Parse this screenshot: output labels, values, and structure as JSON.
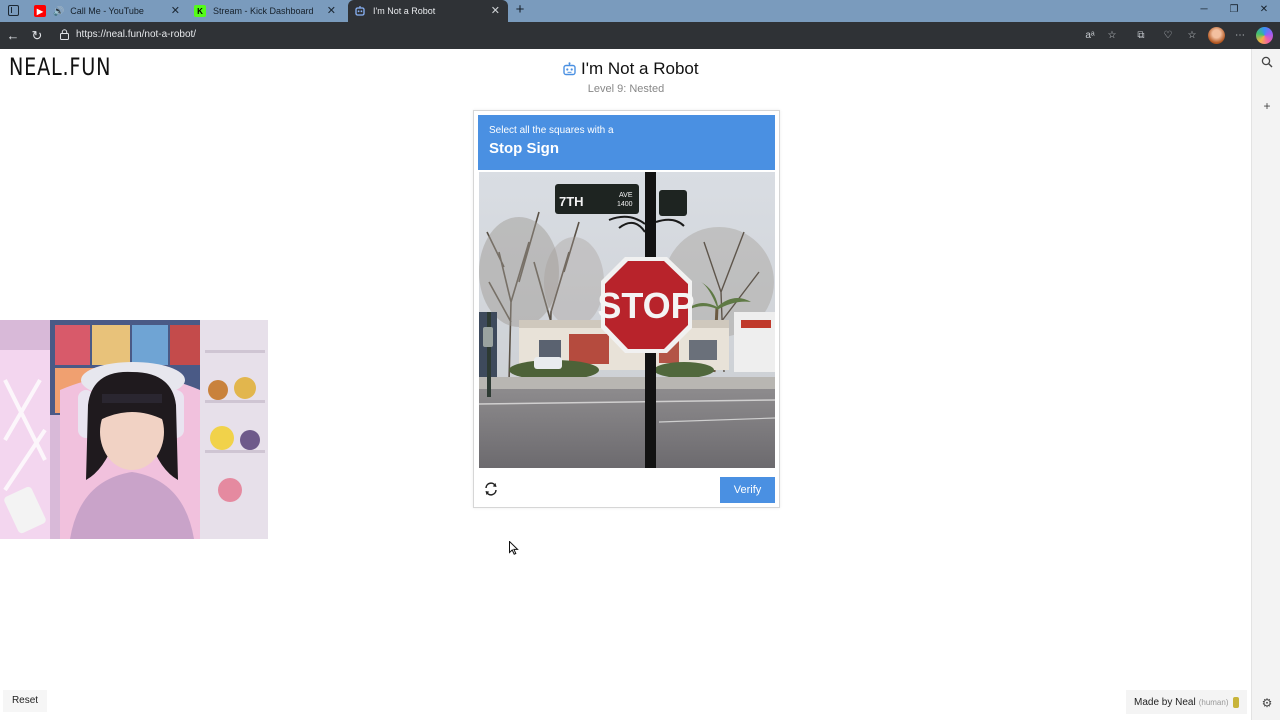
{
  "browser": {
    "tabs": [
      {
        "label": "Call Me - YouTube",
        "icon": "youtube-icon"
      },
      {
        "label": "Stream - Kick Dashboard",
        "icon": "kick-icon"
      },
      {
        "label": "I'm Not a Robot",
        "icon": "robot-icon",
        "active": true
      }
    ],
    "url": "https://neal.fun/not-a-robot/"
  },
  "page": {
    "logo": "NEAL.FUN",
    "title": "I'm Not a Robot",
    "level": "Level 9: Nested"
  },
  "captcha": {
    "instruction": "Select all the squares with a",
    "target": "Stop Sign",
    "image": {
      "street_sign_name": "7TH",
      "street_sign_suffix": "AVE",
      "street_sign_number": "1400",
      "stop_text": "STOP"
    },
    "verify_label": "Verify",
    "accent_color": "#4a90e2"
  },
  "footer": {
    "reset_label": "Reset",
    "credit": "Made by Neal",
    "credit_note": "(human)"
  }
}
